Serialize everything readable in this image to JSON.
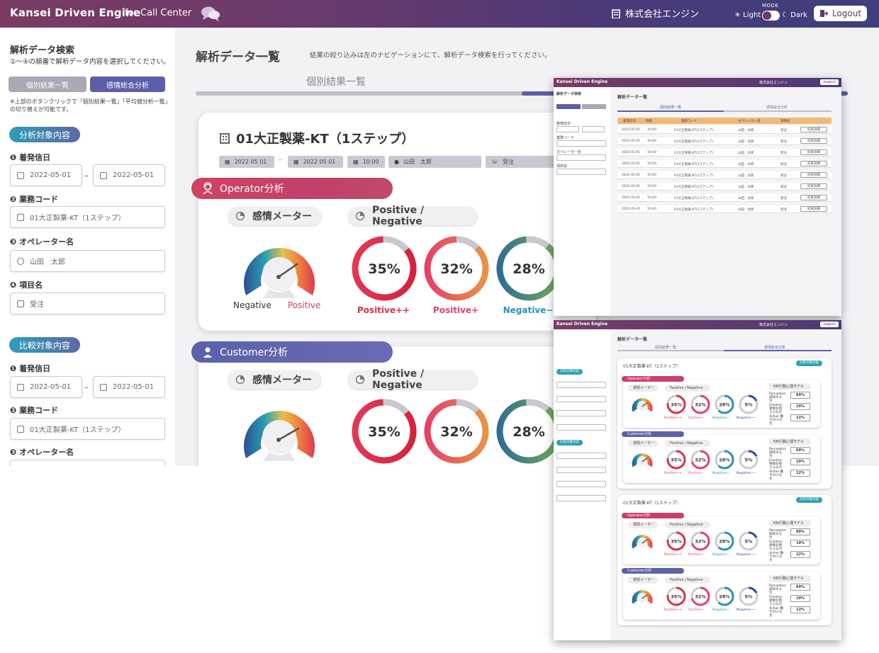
{
  "header": {
    "brand": "Kansei Driven Engine",
    "brand_sub": "for Call Center",
    "company": "株式会社エンジン",
    "mode_label": "MODE",
    "mode_light": "Light",
    "mode_dark": "Dark",
    "logout": "Logout"
  },
  "sidebar": {
    "title": "解析データ検索",
    "subtitle": "①〜④の順番で解析データ内容を選択してください。",
    "btn_individual": "個別結果一覧",
    "btn_emotion": "感情総合分析",
    "note": "※上部のボタンクリックで「個別結果一覧」「平均値分析一覧」の切り替えが可能です。",
    "target_section": "分析対象内容",
    "compare_section": "比較対象内容",
    "label_date": "❶ 着発信日",
    "label_code": "❷ 業務コード",
    "label_operator": "❸ オペレーター名",
    "label_item": "❹ 項目名",
    "date_from": "2022-05-01",
    "date_to": "2022-05-01",
    "code": "01大正製薬-KT（1ステップ）",
    "operator": "山田　太郎",
    "item": "受注",
    "dash": "–"
  },
  "content": {
    "title": "解析データ一覧",
    "desc": "結果の絞り込みは左のナビゲーションにて、解析データ検索を行ってください。",
    "tab_individual": "個別結果一覧",
    "tab_emotion": "感情総合分析"
  },
  "card": {
    "title": "01大正製薬-KT（1ステップ）",
    "meta": [
      "2022 05 01",
      "2022 05 01",
      "10:00",
      "山田　太郎",
      "受注"
    ],
    "meta_dash": "–",
    "operator_band": "Operator分析",
    "customer_band": "Customer分析",
    "meter_pill": "感情メーター",
    "pn_pill": "Positive / Negative",
    "gauge_negative": "Negative",
    "gauge_positive": "Positive",
    "rings": [
      {
        "value": "35%",
        "label": "Positive++",
        "color": "#e0304a"
      },
      {
        "value": "32%",
        "label": "Positive+",
        "color": "#e2407a"
      },
      {
        "value": "28%",
        "label": "Negative−",
        "color": "#2a92b6"
      }
    ]
  },
  "thumb1": {
    "brand": "Kansei Driven Engine",
    "company": "株式会社エンジン",
    "logout": "Logout",
    "title": "解析データ検索",
    "content_title": "解析データ一覧",
    "tab_individual": "個別結果一覧",
    "tab_emotion": "感情総合分析",
    "headers": [
      "着発信日",
      "時間",
      "業務コード",
      "オペレーター名",
      "項目名"
    ],
    "row": {
      "date": "2022-05-01",
      "time": "10:00",
      "code": "01大正製薬-KT(1ステップ)",
      "operator": "山田　太郎",
      "item": "受注",
      "button": "結果詳細"
    },
    "field_labels": [
      "着発信日",
      "業務コード",
      "オペレーター名",
      "項目名"
    ],
    "row_count": 8
  },
  "thumb2": {
    "brand": "Kansei Driven Engine",
    "company": "株式会社エンジン",
    "logout": "Logout",
    "content_title": "解析データ一覧",
    "tab_individual": "個別結果一覧",
    "tab_emotion": "感情総合分析",
    "card_title": "01大正製薬-KT（1ステップ）",
    "tag": "分析対象内容",
    "operator_band": "Operator分析",
    "customer_band": "Customer分析",
    "meter": "感情メーター",
    "pn": "Positive / Negative",
    "kbi": "KBI行動心理モデル",
    "rings": [
      "35%",
      "32%",
      "28%",
      "5%"
    ],
    "ring_labels": [
      "Positive++",
      "Positive+",
      "Negative−",
      "Negative−−"
    ],
    "kbi_labels": [
      "Perception 認知する力",
      "Emotion 感情を揺さぶる力",
      "Action 働きかける力"
    ],
    "kbi_values": [
      "69%",
      "19%",
      "12%"
    ],
    "sec1": "分析対象内容",
    "sec2": "比較対象内容"
  }
}
